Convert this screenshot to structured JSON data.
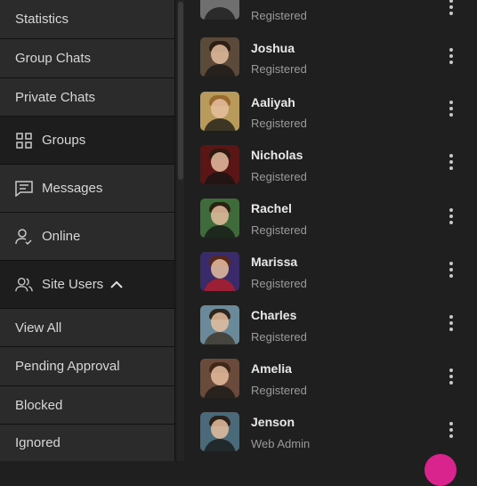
{
  "sidebar": {
    "items": [
      {
        "label": "Statistics",
        "icon": ""
      },
      {
        "label": "Group Chats",
        "icon": ""
      },
      {
        "label": "Private Chats",
        "icon": ""
      },
      {
        "label": "Groups",
        "icon": "grid-icon"
      },
      {
        "label": "Messages",
        "icon": "message-icon"
      },
      {
        "label": "Online",
        "icon": "user-check-icon"
      },
      {
        "label": "Site Users",
        "icon": "users-icon",
        "expanded": true,
        "chevron": "chevron-up-icon"
      },
      {
        "label": "View All",
        "icon": ""
      },
      {
        "label": "Pending Approval",
        "icon": ""
      },
      {
        "label": "Blocked",
        "icon": ""
      },
      {
        "label": "Ignored",
        "icon": ""
      }
    ]
  },
  "users": [
    {
      "name": "",
      "role": "Registered",
      "avatar_bg": "#6f6f6f"
    },
    {
      "name": "Joshua",
      "role": "Registered",
      "avatar_bg": "#5b4a3a"
    },
    {
      "name": "Aaliyah",
      "role": "Registered",
      "avatar_bg": "#b89a5a"
    },
    {
      "name": "Nicholas",
      "role": "Registered",
      "avatar_bg": "#5a1515"
    },
    {
      "name": "Rachel",
      "role": "Registered",
      "avatar_bg": "#3f6a3a"
    },
    {
      "name": "Marissa",
      "role": "Registered",
      "avatar_bg": "#3b2a6a"
    },
    {
      "name": "Charles",
      "role": "Registered",
      "avatar_bg": "#6a8a9a"
    },
    {
      "name": "Amelia",
      "role": "Registered",
      "avatar_bg": "#6a4a3a"
    },
    {
      "name": "Jenson",
      "role": "Web Admin",
      "avatar_bg": "#4a6a7a"
    }
  ],
  "colors": {
    "accent": "#d9238d",
    "sidebar": "#2b2b2b",
    "background": "#1f1f20"
  }
}
